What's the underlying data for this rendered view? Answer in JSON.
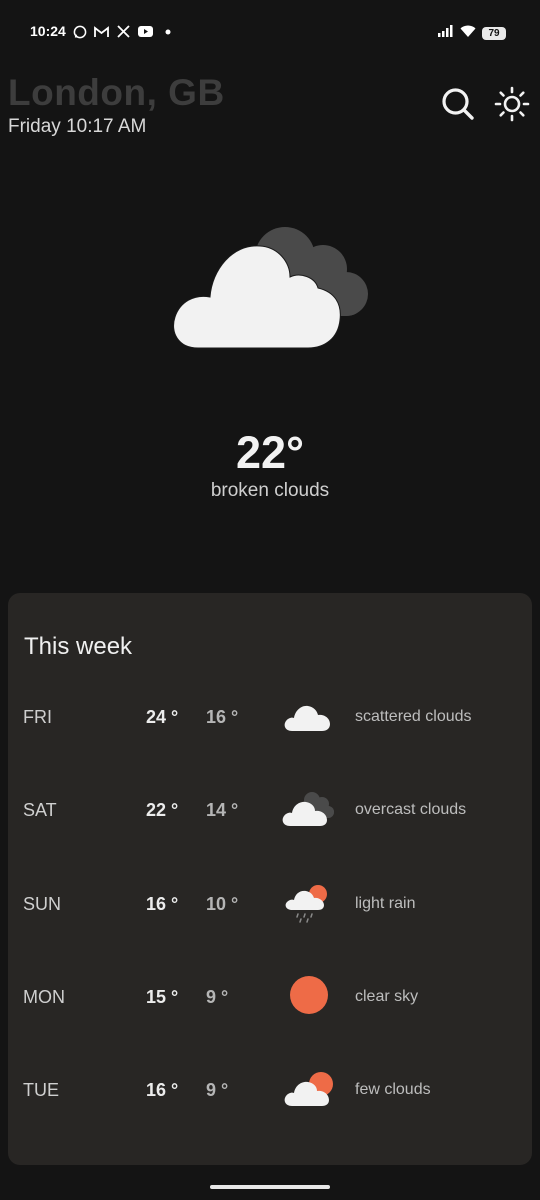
{
  "status_bar": {
    "time": "10:24",
    "battery": "79",
    "left_icons": [
      "whatsapp-icon",
      "gmail-icon",
      "x-icon",
      "youtube-icon",
      "dot-icon"
    ],
    "right_icons": [
      "signal-icon",
      "wifi-icon",
      "battery-icon"
    ]
  },
  "header": {
    "city": "London, GB",
    "datetime": "Friday 10:17 AM",
    "search_icon": "search-icon",
    "theme_icon": "sun-icon"
  },
  "current": {
    "icon": "broken-clouds-icon",
    "temperature": "22°",
    "description": "broken clouds"
  },
  "week": {
    "title": "This week",
    "days": [
      {
        "day": "FRI",
        "high": "24 °",
        "low": "16 °",
        "icon": "scattered-clouds-icon",
        "description": "scattered clouds"
      },
      {
        "day": "SAT",
        "high": "22 °",
        "low": "14 °",
        "icon": "overcast-clouds-icon",
        "description": "overcast clouds"
      },
      {
        "day": "SUN",
        "high": "16 °",
        "low": "10 °",
        "icon": "light-rain-icon",
        "description": "light rain"
      },
      {
        "day": "MON",
        "high": "15 °",
        "low": "9 °",
        "icon": "clear-sky-icon",
        "description": "clear sky"
      },
      {
        "day": "TUE",
        "high": "16 °",
        "low": "9 °",
        "icon": "few-clouds-icon",
        "description": "few clouds"
      }
    ]
  },
  "colors": {
    "background": "#141414",
    "card": "#282624",
    "sun": "#ee6b47",
    "cloud": "#f2f2f2",
    "dark_cloud": "#4a4a4a"
  }
}
